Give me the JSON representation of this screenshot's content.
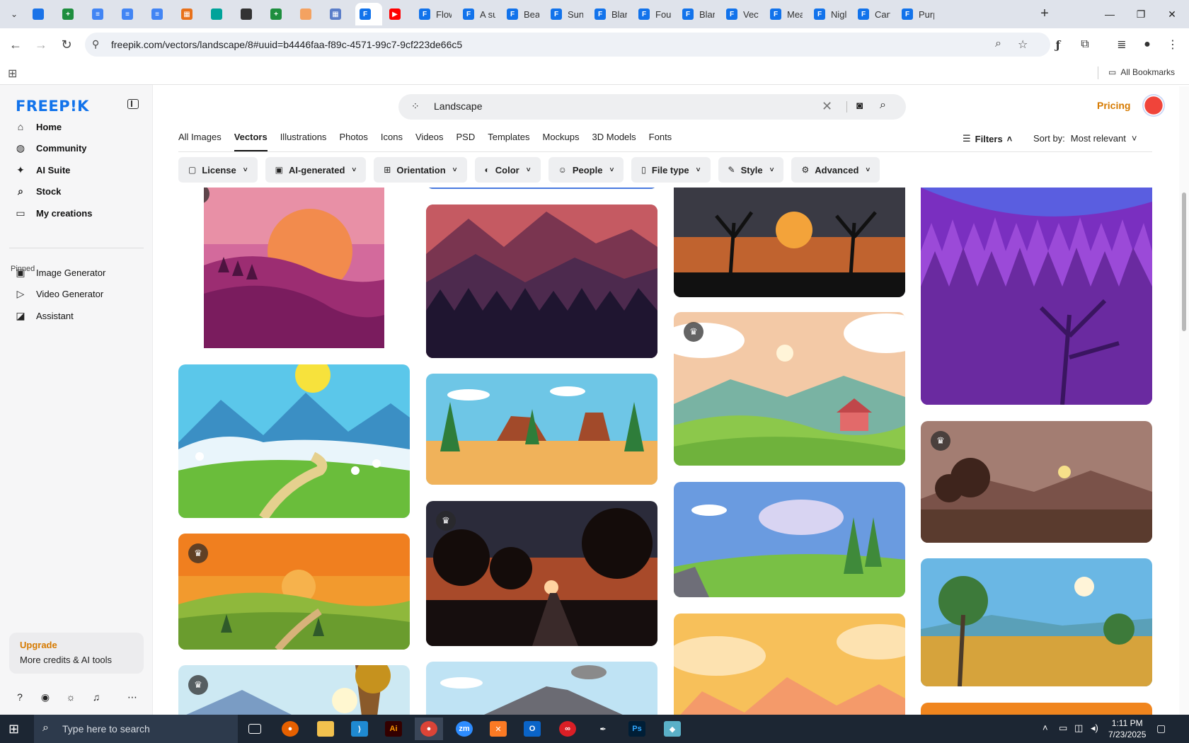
{
  "browser": {
    "tabs": [
      {
        "icon": "",
        "color": "#1a73e8",
        "label": ""
      },
      {
        "icon": "+",
        "color": "#1e8e3e",
        "label": ""
      },
      {
        "icon": "≡",
        "color": "#4285f4",
        "label": ""
      },
      {
        "icon": "≡",
        "color": "#4285f4",
        "label": ""
      },
      {
        "icon": "≡",
        "color": "#4285f4",
        "label": ""
      },
      {
        "icon": "▦",
        "color": "#e8711a",
        "label": ""
      },
      {
        "icon": "",
        "color": "#00a39a",
        "label": ""
      },
      {
        "icon": "",
        "color": "#333333",
        "label": ""
      },
      {
        "icon": "+",
        "color": "#1e8e3e",
        "label": ""
      },
      {
        "icon": "",
        "color": "#f4a261",
        "label": ""
      },
      {
        "icon": "▦",
        "color": "#5b7ec9",
        "label": ""
      },
      {
        "icon": "F",
        "color": "#1273eb",
        "label": "",
        "active": true
      },
      {
        "icon": "▶",
        "color": "#ff0000",
        "label": ""
      },
      {
        "icon": "F",
        "color": "#1273eb",
        "label": "Flow"
      },
      {
        "icon": "F",
        "color": "#1273eb",
        "label": "A su"
      },
      {
        "icon": "F",
        "color": "#1273eb",
        "label": "Bea"
      },
      {
        "icon": "F",
        "color": "#1273eb",
        "label": "Sun"
      },
      {
        "icon": "F",
        "color": "#1273eb",
        "label": "Blar"
      },
      {
        "icon": "F",
        "color": "#1273eb",
        "label": "Four"
      },
      {
        "icon": "F",
        "color": "#1273eb",
        "label": "Blar"
      },
      {
        "icon": "F",
        "color": "#1273eb",
        "label": "Vect"
      },
      {
        "icon": "F",
        "color": "#1273eb",
        "label": "Mea"
      },
      {
        "icon": "F",
        "color": "#1273eb",
        "label": "Nigl"
      },
      {
        "icon": "F",
        "color": "#1273eb",
        "label": "Cart"
      },
      {
        "icon": "F",
        "color": "#1273eb",
        "label": "Purp"
      }
    ],
    "new_tab": "+",
    "url": "freepik.com/vectors/landscape/8#uuid=b4446faa-f89c-4571-99c7-9cf223de66c5",
    "bookmarks_label": "All Bookmarks"
  },
  "sidebar": {
    "logo": "FREEP!K",
    "nav": [
      {
        "label": "Home",
        "icon": "⌂"
      },
      {
        "label": "Community",
        "icon": "◍"
      },
      {
        "label": "AI Suite",
        "icon": "✦"
      },
      {
        "label": "Stock",
        "icon": "⌕"
      },
      {
        "label": "My creations",
        "icon": "▭"
      }
    ],
    "pinned_label": "Pinned",
    "pinned": [
      {
        "label": "Image Generator",
        "icon": "▣"
      },
      {
        "label": "Video Generator",
        "icon": "▷"
      },
      {
        "label": "Assistant",
        "icon": "◪"
      }
    ],
    "upgrade": {
      "title": "Upgrade",
      "subtitle": "More credits & AI tools"
    }
  },
  "search": {
    "value": "Landscape"
  },
  "header": {
    "pricing": "Pricing"
  },
  "categories": {
    "items": [
      "All Images",
      "Vectors",
      "Illustrations",
      "Photos",
      "Icons",
      "Videos",
      "PSD",
      "Templates",
      "Mockups",
      "3D Models",
      "Fonts"
    ],
    "selected": "Vectors"
  },
  "filters_label": "Filters",
  "sort": {
    "label": "Sort by:",
    "value": "Most relevant"
  },
  "chips": [
    {
      "label": "License",
      "icon": "▢"
    },
    {
      "label": "AI-generated",
      "icon": "▣"
    },
    {
      "label": "Orientation",
      "icon": "⊞"
    },
    {
      "label": "Color",
      "icon": "◐"
    },
    {
      "label": "People",
      "icon": "☺"
    },
    {
      "label": "File type",
      "icon": "▯"
    },
    {
      "label": "Style",
      "icon": "✎"
    },
    {
      "label": "Advanced",
      "icon": "⚙"
    }
  ],
  "taskbar": {
    "search_placeholder": "Type here to search",
    "time": "1:11 PM",
    "date": "7/23/2025"
  }
}
